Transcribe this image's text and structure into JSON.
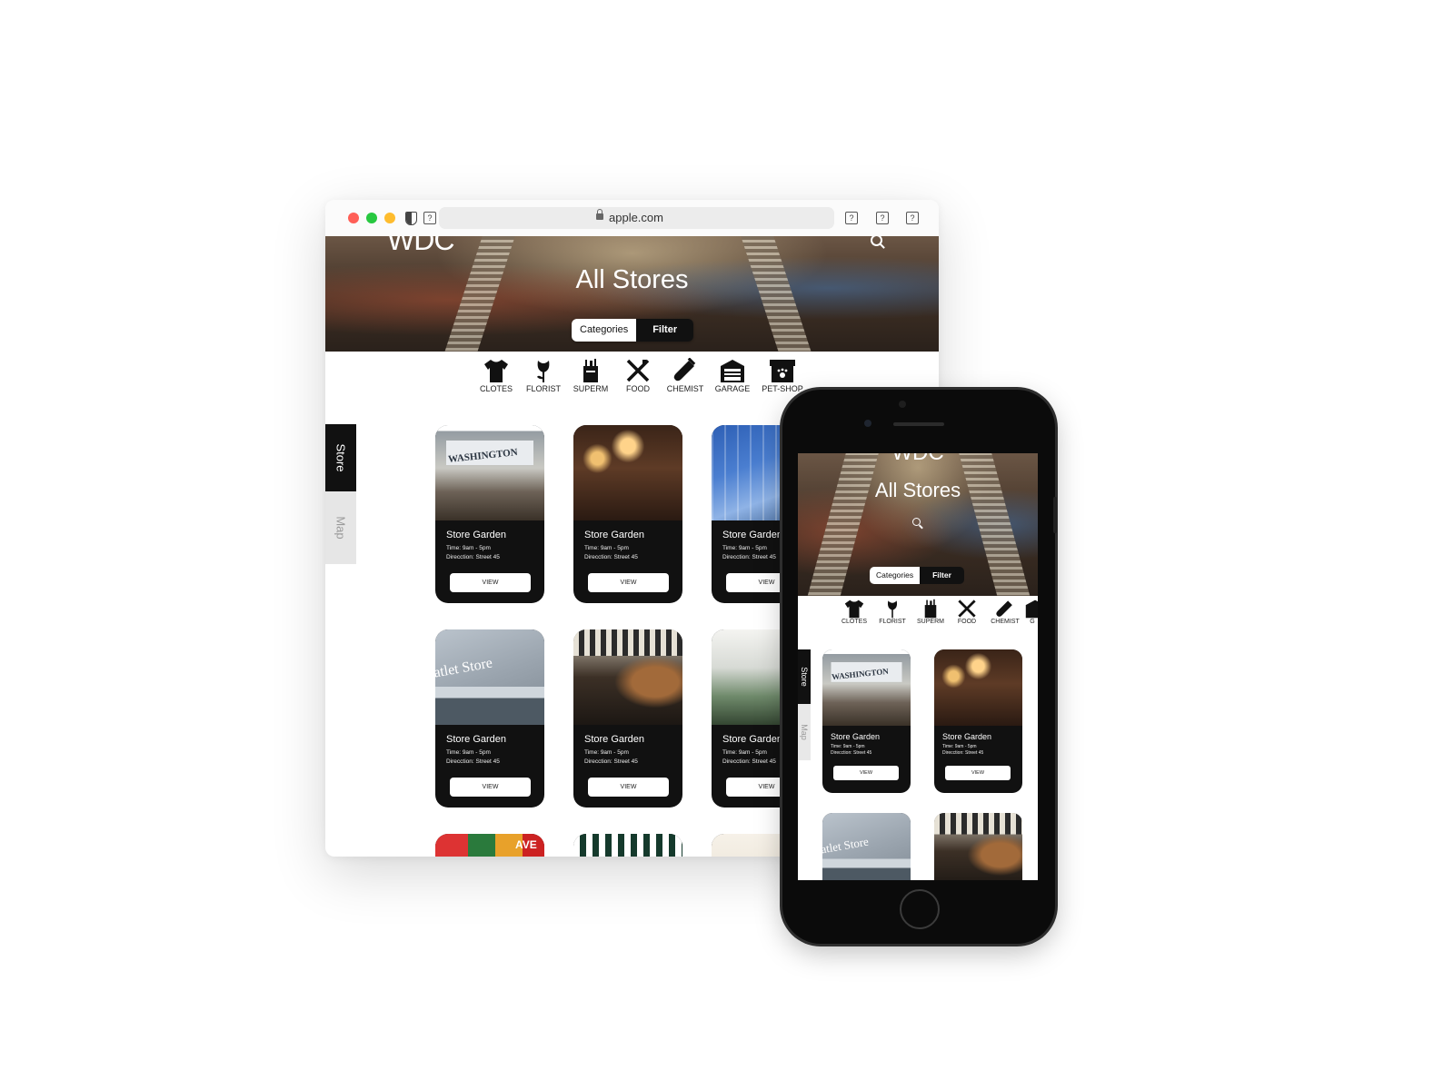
{
  "browser": {
    "url": "apple.com",
    "traffic_lights": {
      "close": "#ff5f57",
      "minimize": "#28c840",
      "zoom": "#febc2e"
    },
    "toolbar_glyph": "?"
  },
  "site": {
    "logo": "WDC",
    "title": "All Stores",
    "toggle": {
      "categories": "Categories",
      "filter": "Filter"
    },
    "categories": [
      {
        "icon": "tshirt-icon",
        "label": "CLOTES"
      },
      {
        "icon": "flower-icon",
        "label": "FLORIST"
      },
      {
        "icon": "grocery-bag-icon",
        "label": "SUPERM"
      },
      {
        "icon": "fork-knife-icon",
        "label": "FOOD"
      },
      {
        "icon": "test-tube-icon",
        "label": "CHEMIST"
      },
      {
        "icon": "garage-icon",
        "label": "GARAGE"
      },
      {
        "icon": "pet-shop-icon",
        "label": "PET-SHOP"
      }
    ],
    "side_tabs": {
      "store": "Store",
      "map": "Map"
    },
    "stores": [
      {
        "name": "Store Garden",
        "time": "Time: 9am - 5pm",
        "direction": "Direcction: Street 45",
        "button": "VIEW"
      },
      {
        "name": "Store Garden",
        "time": "Time: 9am - 5pm",
        "direction": "Direcction: Street 45",
        "button": "VIEW"
      },
      {
        "name": "Store Garden",
        "time": "Time: 9am - 5pm",
        "direction": "Direcction: Street 45",
        "button": "VIEW"
      },
      {
        "name": "Store Garden",
        "time": "Time: 9am - 5pm",
        "direction": "Direcction: Street 45",
        "button": "VIEW"
      },
      {
        "name": "Store Garden",
        "time": "Time: 9am - 5pm",
        "direction": "Direcction: Street 45",
        "button": "VIEW"
      },
      {
        "name": "Store Garden",
        "time": "Time: 9am - 5pm",
        "direction": "Direcction: Street 45",
        "button": "VIEW"
      }
    ],
    "photo_text": {
      "washington": "WASHINGTON",
      "outlet": "atlet Store",
      "ave": "AVE"
    }
  },
  "mobile": {
    "logo": "WDC",
    "title": "All Stores",
    "toggle": {
      "categories": "Categories",
      "filter": "Filter"
    },
    "categories": [
      {
        "icon": "tshirt-icon",
        "label": "CLOTES"
      },
      {
        "icon": "flower-icon",
        "label": "FLORIST"
      },
      {
        "icon": "grocery-bag-icon",
        "label": "SUPERM"
      },
      {
        "icon": "fork-knife-icon",
        "label": "FOOD"
      },
      {
        "icon": "test-tube-icon",
        "label": "CHEMIST"
      },
      {
        "icon": "garage-icon",
        "label": "G"
      }
    ],
    "side_tabs": {
      "store": "Store",
      "map": "Map"
    },
    "stores": [
      {
        "name": "Store Garden",
        "time": "Time: 9am - 5pm",
        "direction": "Direcction: Street 45",
        "button": "VIEW"
      },
      {
        "name": "Store Garden",
        "time": "Time: 9am - 5pm",
        "direction": "Direcction: Street 45",
        "button": "VIEW"
      }
    ]
  }
}
